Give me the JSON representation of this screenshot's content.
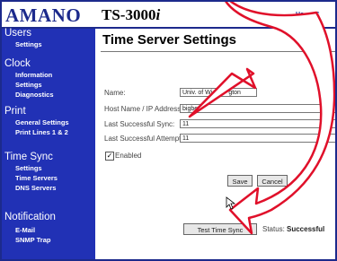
{
  "brand": {
    "logo": "AMANO",
    "model": "TS-3000",
    "model_suffix": "i"
  },
  "top_nav": {
    "links": [
      "Ho",
      "C"
    ]
  },
  "sidebar": {
    "sections": [
      {
        "title": "Users",
        "items": [
          "Settings"
        ]
      },
      {
        "title": "Clock",
        "items": [
          "Information",
          "Settings",
          "Diagnostics"
        ]
      },
      {
        "title": "Print",
        "items": [
          "General Settings",
          "Print Lines 1 & 2"
        ]
      },
      {
        "title": "Time Sync",
        "items": [
          "Settings",
          "Time Servers",
          "DNS Servers"
        ]
      },
      {
        "title": "Notification",
        "items": [
          "E-Mail",
          "SNMP Trap"
        ]
      }
    ]
  },
  "main": {
    "title": "Time Server Settings",
    "fields": {
      "name": {
        "label": "Name:",
        "value": "Univ. of Wi",
        "value_tail": "gton"
      },
      "host": {
        "label": "Host Name / IP Address:",
        "value": "bigben"
      },
      "last_sync": {
        "label": "Last Successful Sync:",
        "value": "11"
      },
      "last_attempt": {
        "label": "Last Successful Attempt:",
        "value": "11"
      }
    },
    "enabled": {
      "label": "Enabled",
      "checked": true
    },
    "buttons": {
      "save": "Save",
      "cancel": "Cancel",
      "test": "Test Time Sync"
    },
    "status": {
      "label": "Status:",
      "value": "Successful"
    }
  },
  "colors": {
    "nav_blue": "#2131b5",
    "callout_red": "#e0102a"
  }
}
